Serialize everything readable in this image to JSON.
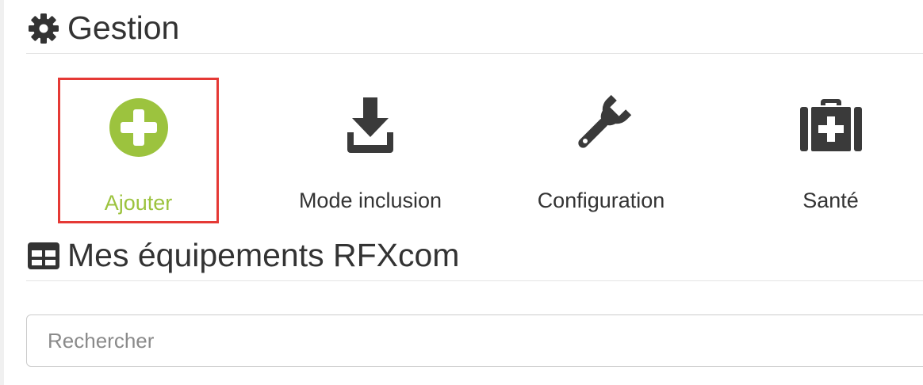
{
  "gestion": {
    "title": "Gestion",
    "icon": "gear-icon"
  },
  "actions": [
    {
      "label": "Ajouter",
      "icon": "plus-circle-icon",
      "selected": true,
      "color": "#9cc33e"
    },
    {
      "label": "Mode inclusion",
      "icon": "download-icon",
      "selected": false
    },
    {
      "label": "Configuration",
      "icon": "wrench-icon",
      "selected": false
    },
    {
      "label": "Santé",
      "icon": "medkit-icon",
      "selected": false
    }
  ],
  "equipements": {
    "title": "Mes équipements RFXcom",
    "icon": "table-icon"
  },
  "search": {
    "placeholder": "Rechercher",
    "value": ""
  },
  "colors": {
    "accent": "#9cc33e",
    "selection_border": "#e53935",
    "text": "#333333",
    "icon_dark": "#3a3a3a"
  }
}
